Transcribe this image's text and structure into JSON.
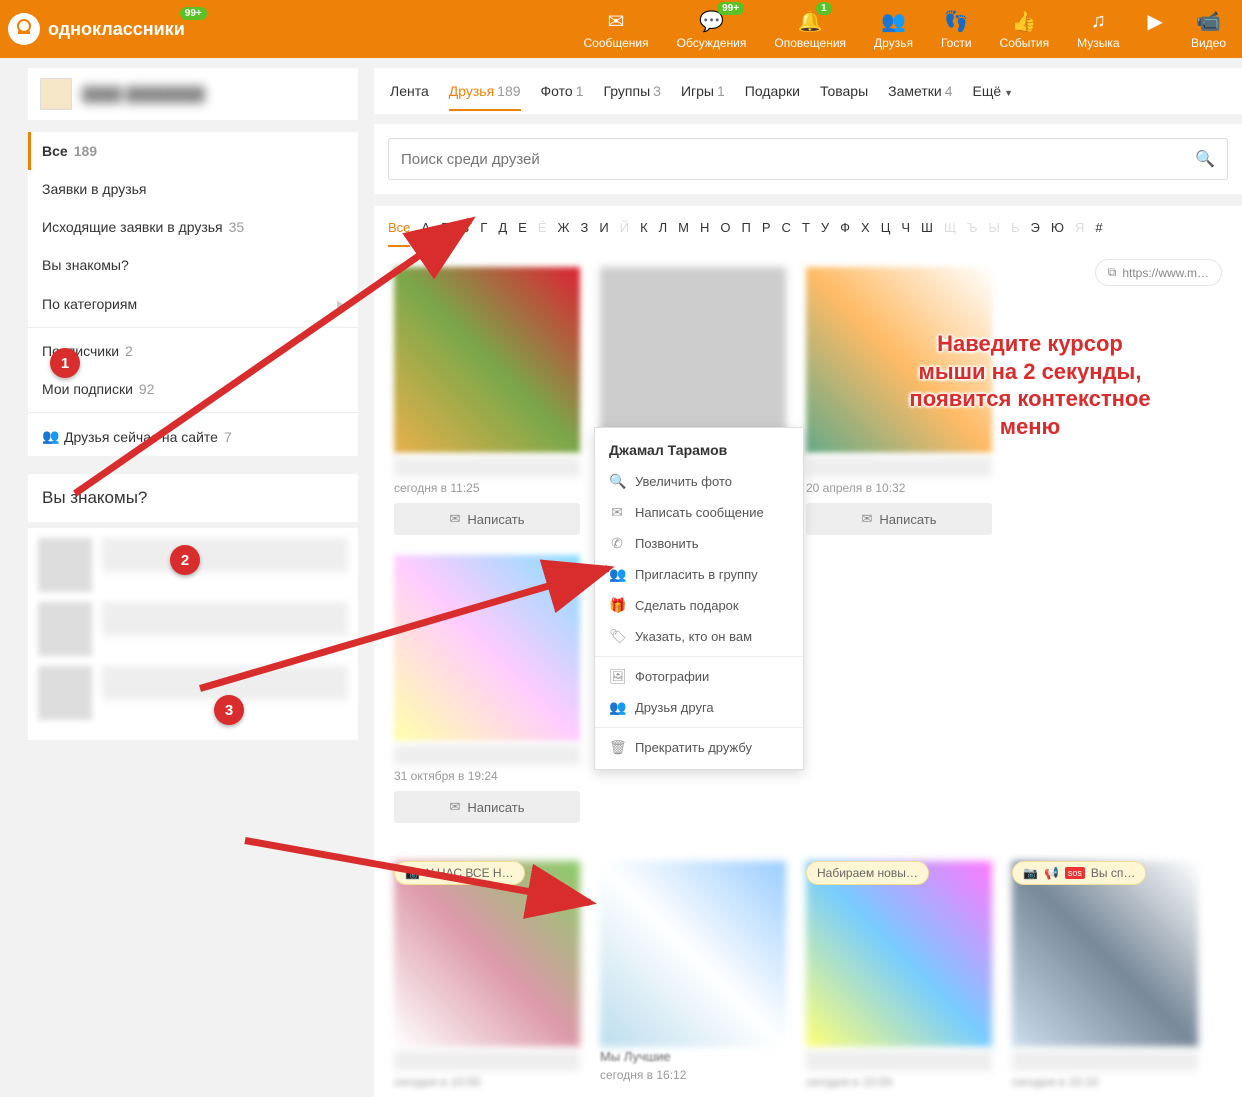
{
  "header": {
    "site_name": "одноклассники",
    "badge_logo": "99+",
    "nav": [
      {
        "label": "Сообщения",
        "icon": "envelope"
      },
      {
        "label": "Обсуждения",
        "icon": "chat",
        "badge": "99+"
      },
      {
        "label": "Оповещения",
        "icon": "bell",
        "badge": "1"
      },
      {
        "label": "Друзья",
        "icon": "people"
      },
      {
        "label": "Гости",
        "icon": "footsteps"
      },
      {
        "label": "События",
        "icon": "thumbs"
      },
      {
        "label": "Музыка",
        "icon": "music"
      },
      {
        "label": "",
        "icon": "video-play"
      },
      {
        "label": "Видео",
        "icon": "camera"
      }
    ]
  },
  "tabs": [
    {
      "label": "Лента"
    },
    {
      "label": "Друзья",
      "count": "189",
      "active": true
    },
    {
      "label": "Фото",
      "count": "1"
    },
    {
      "label": "Группы",
      "count": "3"
    },
    {
      "label": "Игры",
      "count": "1"
    },
    {
      "label": "Подарки"
    },
    {
      "label": "Товары"
    },
    {
      "label": "Заметки",
      "count": "4"
    },
    {
      "label": "Ещё",
      "more": true
    }
  ],
  "sidebar": {
    "items": [
      {
        "label": "Все",
        "count": "189",
        "active": true
      },
      {
        "label": "Заявки в друзья"
      },
      {
        "label": "Исходящие заявки в друзья",
        "count": "35"
      },
      {
        "label": "Вы знакомы?"
      },
      {
        "label": "По категориям",
        "arrow": true
      }
    ],
    "items2": [
      {
        "label": "Подписчики",
        "count": "2"
      },
      {
        "label": "Мои подписки",
        "count": "92"
      }
    ],
    "online": {
      "label": "Друзья сейчас на сайте",
      "count": "7"
    },
    "suggest_title": "Вы знакомы?"
  },
  "search": {
    "placeholder": "Поиск среди друзей"
  },
  "alpha": {
    "letters": [
      "Все",
      "А",
      "Б",
      "В",
      "Г",
      "Д",
      "Е",
      "Ё",
      "Ж",
      "З",
      "И",
      "Й",
      "К",
      "Л",
      "М",
      "Н",
      "О",
      "П",
      "Р",
      "С",
      "Т",
      "У",
      "Ф",
      "Х",
      "Ц",
      "Ч",
      "Ш",
      "Щ",
      "Ъ",
      "Ы",
      "Ь",
      "Э",
      "Ю",
      "Я",
      "#"
    ],
    "disabled": [
      "Ё",
      "Й",
      "Щ",
      "Ъ",
      "Ы",
      "Ь",
      "Я"
    ],
    "selected": "Все"
  },
  "url_pill": "https://www.m…",
  "annotation": {
    "steps": [
      "1",
      "2",
      "3"
    ],
    "tip": "Наведите курсор\nмыши на 2 секунды,\nпоявится контекстное\nменю"
  },
  "friends": [
    {
      "time": "сегодня в 11:25",
      "write": "Написать"
    },
    {
      "time": "",
      "write": "",
      "context_name": "Джамал Тарамов"
    },
    {
      "time": "20 апреля в 10:32",
      "write": "Написать"
    },
    {
      "time": "31 октября в 19:24",
      "write": "Написать"
    }
  ],
  "row2_status": [
    {
      "text": "У НАС ВСЕ Н…",
      "icons": [
        "camera"
      ]
    },
    {
      "text": "Мы Лучшие",
      "time": "сегодня в 16:12"
    },
    {
      "text": "Набираем новы…",
      "icons": []
    },
    {
      "text": "Вы сп…",
      "icons": [
        "camera",
        "megaphone",
        "sos"
      ]
    }
  ],
  "context_menu": {
    "title": "Джамал Тарамов",
    "items": [
      {
        "icon": "zoom",
        "label": "Увеличить фото"
      },
      {
        "icon": "envelope",
        "label": "Написать сообщение"
      },
      {
        "icon": "phone",
        "label": "Позвонить"
      },
      {
        "icon": "group",
        "label": "Пригласить в группу"
      },
      {
        "icon": "gift",
        "label": "Сделать подарок"
      },
      {
        "icon": "tag",
        "label": "Указать, кто он вам"
      }
    ],
    "items2": [
      {
        "icon": "photos",
        "label": "Фотографии"
      },
      {
        "icon": "friends",
        "label": "Друзья друга"
      }
    ],
    "items3": [
      {
        "icon": "trash",
        "label": "Прекратить дружбу"
      }
    ]
  }
}
